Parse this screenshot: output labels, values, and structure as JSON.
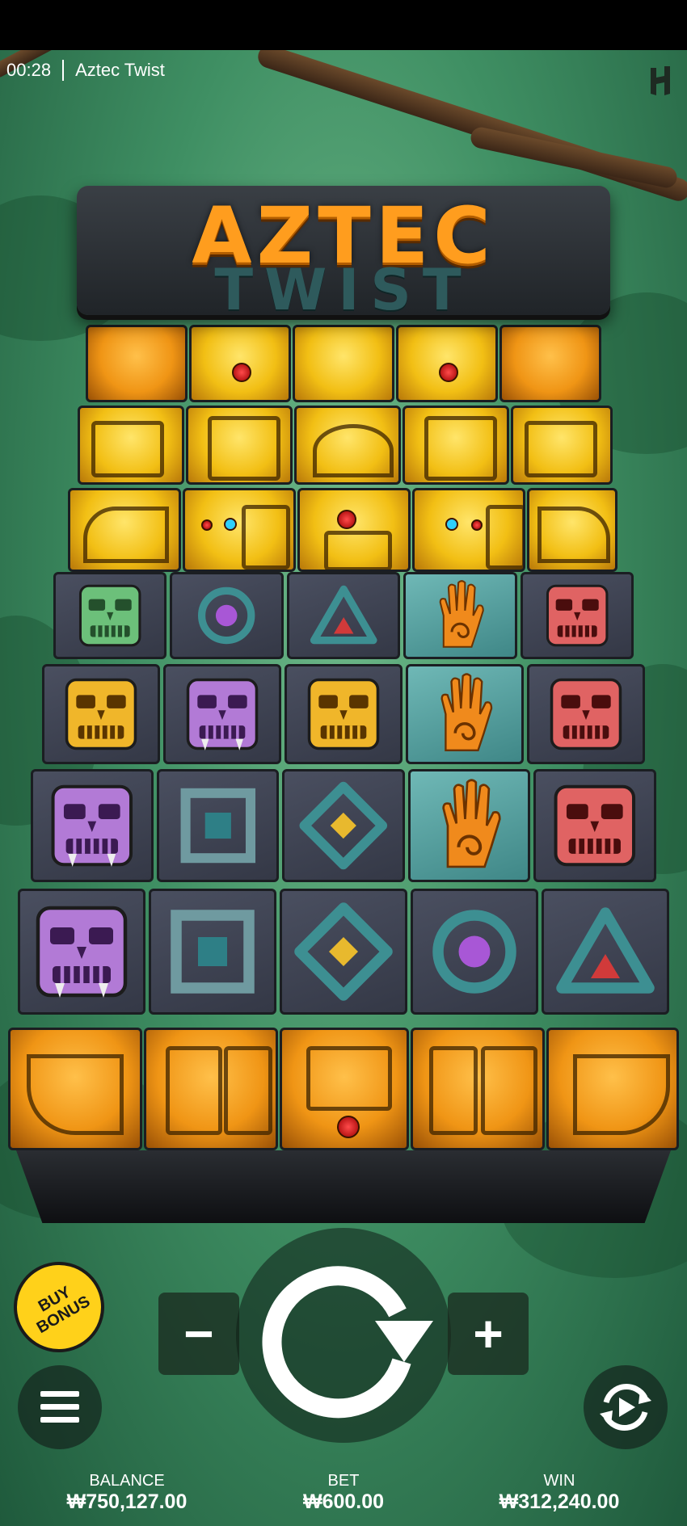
{
  "status_bar": {
    "time": "00:28",
    "game_name": "Aztec Twist"
  },
  "logo": {
    "line1": "AZTEC",
    "line2": "TWIST"
  },
  "reels": {
    "rows": [
      [
        "green-mask",
        "purple-circle",
        "red-triangle",
        "orange-hand",
        "red-mask"
      ],
      [
        "gold-mask",
        "purple-skull",
        "gold-mask",
        "orange-hand",
        "red-mask"
      ],
      [
        "purple-skull",
        "teal-square",
        "gold-diamond",
        "orange-hand",
        "red-mask"
      ],
      [
        "purple-skull",
        "teal-square",
        "gold-diamond",
        "purple-circle",
        "red-triangle"
      ]
    ]
  },
  "controls": {
    "buy_bonus_label": "BUY BONUS",
    "minus_label": "−",
    "plus_label": "+"
  },
  "footer": {
    "balance_label": "BALANCE",
    "balance_value": "₩750,127.00",
    "bet_label": "BET",
    "bet_value": "₩600.00",
    "win_label": "WIN",
    "win_value": "₩312,240.00"
  },
  "colors": {
    "accent_gold": "#f2bf14",
    "accent_orange": "#f09515",
    "buy_bonus": "#ffd11a",
    "jungle_green": "#3f8f63"
  }
}
